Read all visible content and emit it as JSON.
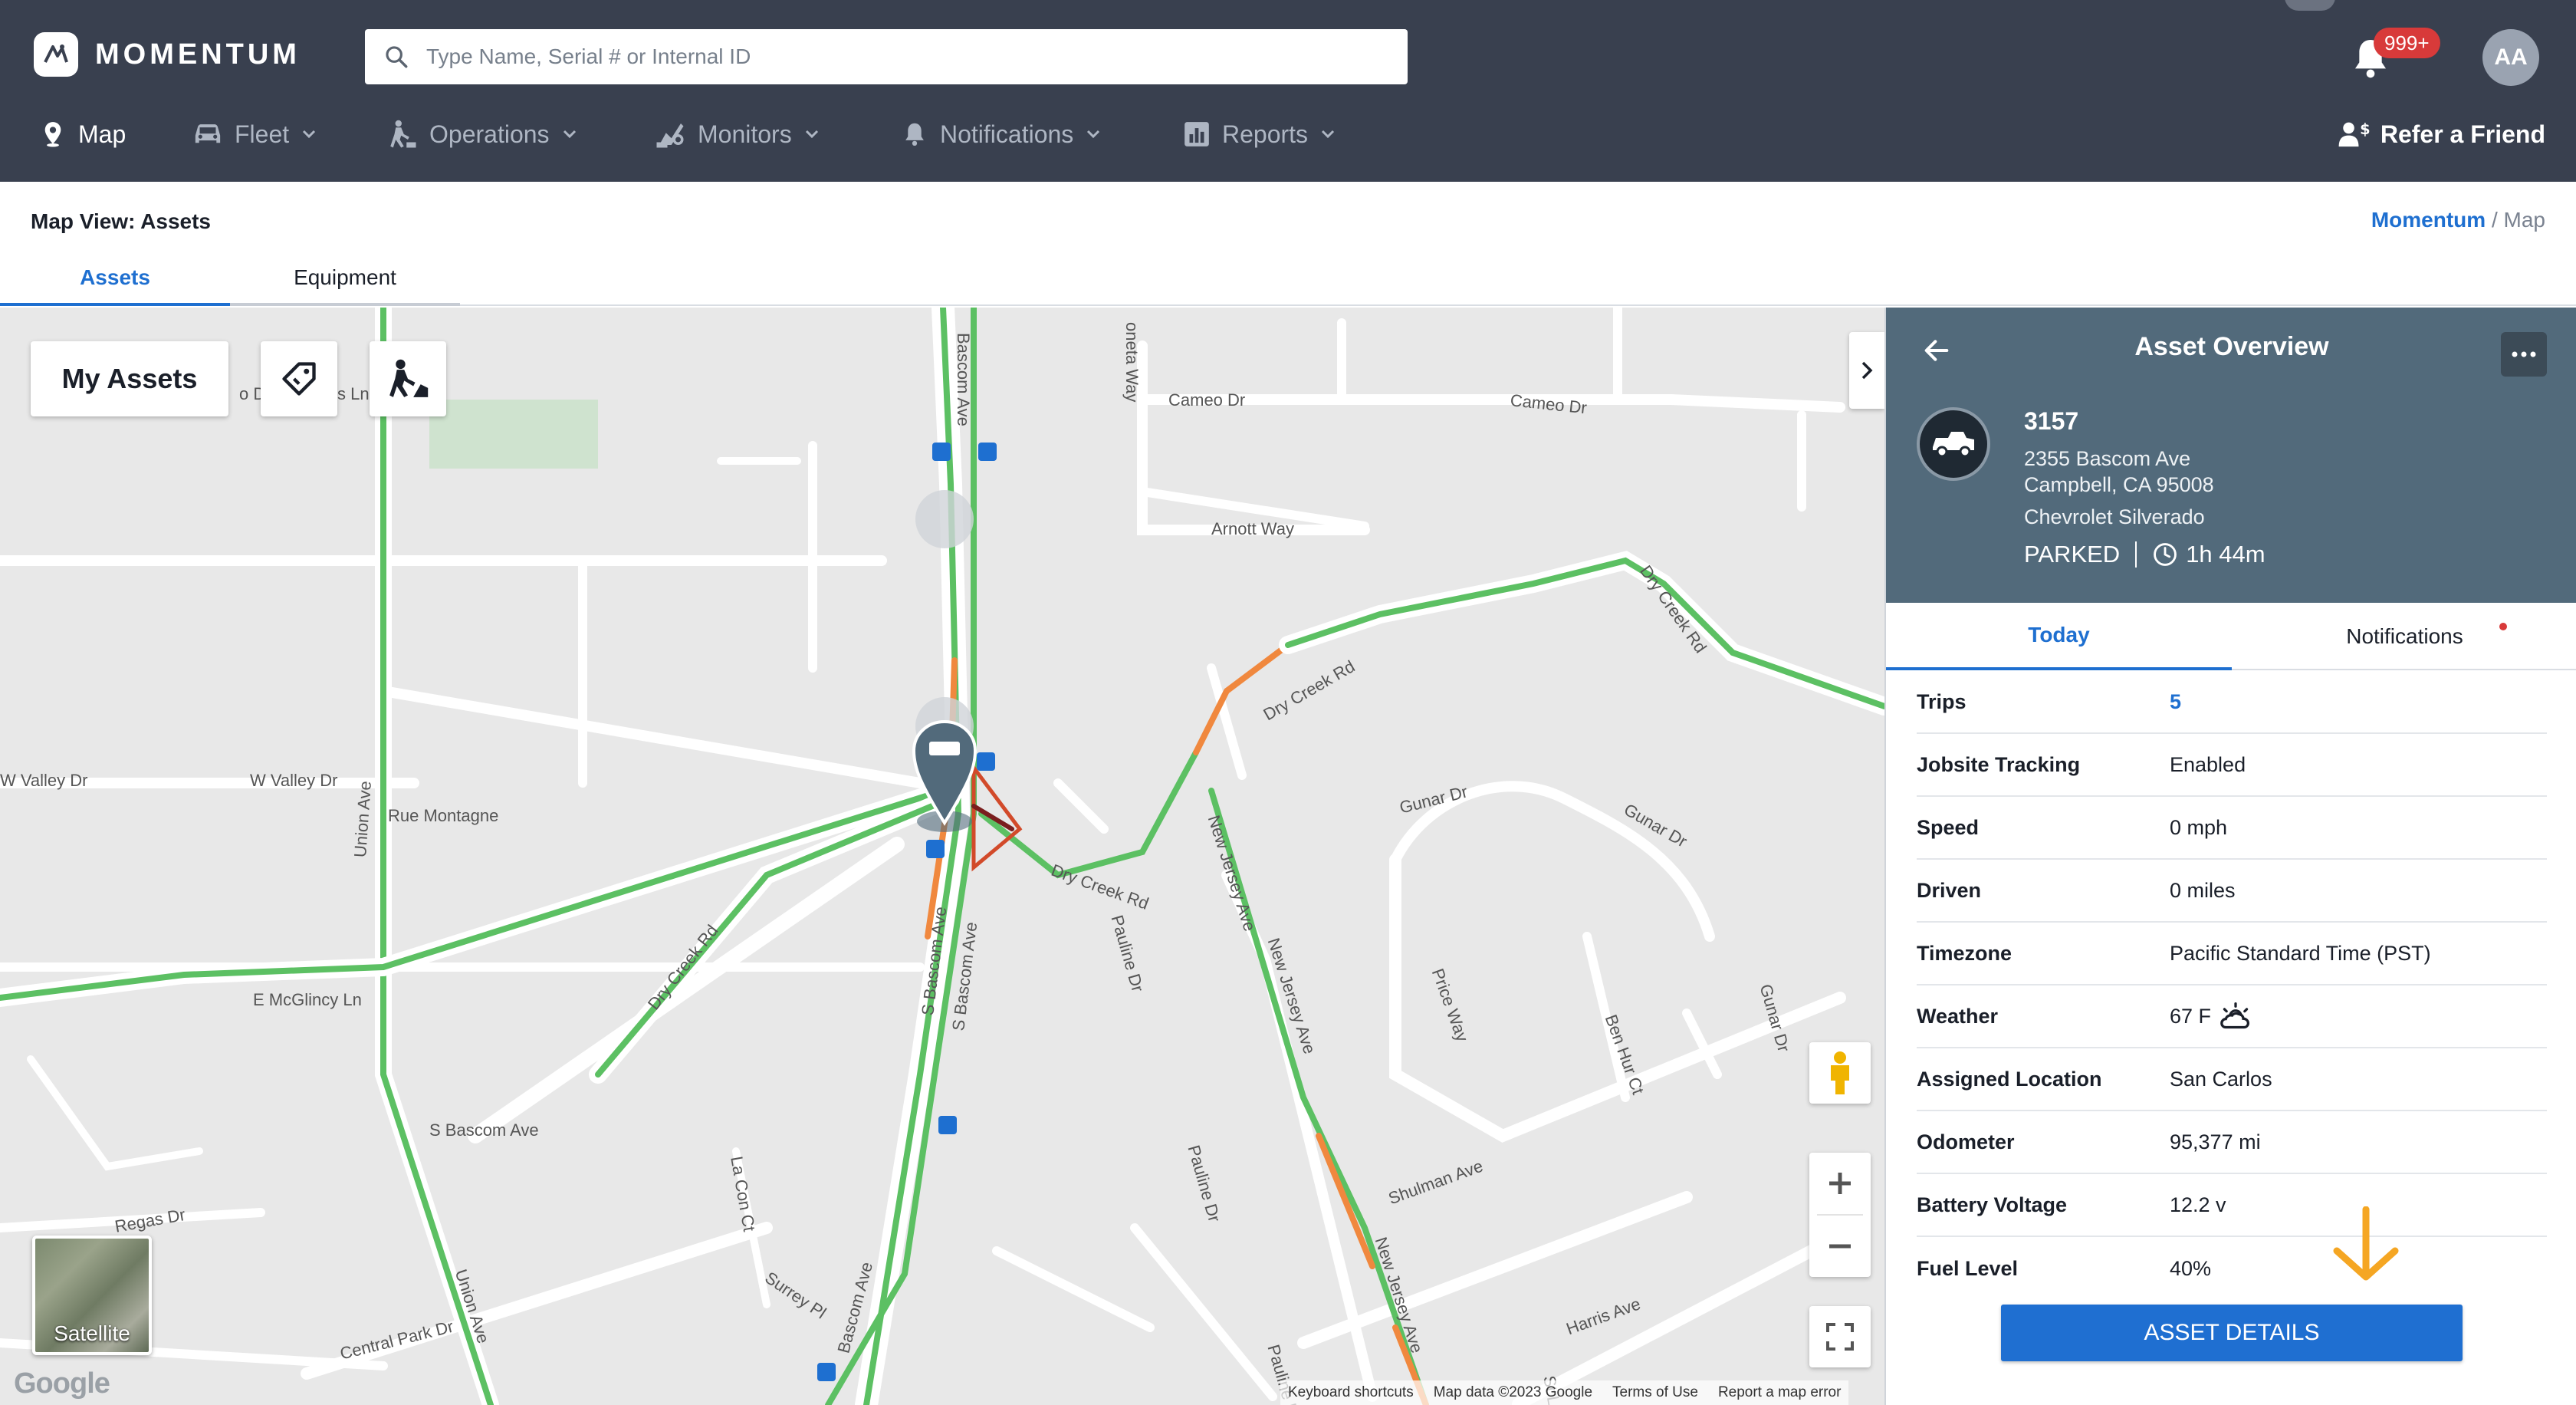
{
  "app": {
    "brand": "MOMENTUM",
    "search_placeholder": "Type Name, Serial # or Internal ID",
    "notifications_badge": "999+",
    "avatar_initials": "AA",
    "nav": [
      {
        "label": "Map",
        "icon": "map-pin-icon",
        "active": true
      },
      {
        "label": "Fleet",
        "icon": "car-icon"
      },
      {
        "label": "Operations",
        "icon": "operations-icon"
      },
      {
        "label": "Monitors",
        "icon": "monitors-icon"
      },
      {
        "label": "Notifications",
        "icon": "bell-icon"
      },
      {
        "label": "Reports",
        "icon": "reports-icon"
      }
    ],
    "refer_label": "Refer a Friend"
  },
  "subheader": {
    "title": "Map View: Assets",
    "breadcrumb_root": "Momentum",
    "breadcrumb_sep": " / ",
    "breadcrumb_current": "Map",
    "tabs": [
      {
        "label": "Assets",
        "active": true
      },
      {
        "label": "Equipment",
        "active": false
      }
    ]
  },
  "map": {
    "my_assets_label": "My Assets",
    "satellite_label": "Satellite",
    "google_logo": "Google",
    "footer": [
      "Keyboard shortcuts",
      "Map data ©2023 Google",
      "Terms of Use",
      "Report a map error"
    ],
    "street_labels": [
      "Cameo Dr",
      "Cameo Dr",
      "Arnott Way",
      "Dry Creek Rd",
      "Dry Creek Rd",
      "Dry Creek Rd",
      "Dry Creek Rd",
      "W Valley Dr",
      "W Valley Dr",
      "Rue Montagne",
      "Union Ave",
      "Union Ave",
      "Bascom Ave",
      "S Bascom Ave",
      "S Bascom Ave",
      "Bascom Ave",
      "S Bascom Ave",
      "E McGlincy Ln",
      "Pauline Dr",
      "Pauline Dr",
      "Pauline Dr",
      "New Jersey Ave",
      "New Jersey Ave",
      "New Jersey Ave",
      "Gunar Dr",
      "Gunar Dr",
      "Gunar Dr",
      "Price Way",
      "Ben Hur Ct",
      "Shulman Ave",
      "Harris Ave",
      "Central Park Dr",
      "Surrey Pl",
      "La Con Ct",
      "Regas Dr",
      "oneta Way",
      "o De",
      "s Ln",
      "St L"
    ]
  },
  "panel": {
    "title": "Asset Overview",
    "asset_id": "3157",
    "address_line1": "2355 Bascom Ave",
    "address_line2": "Campbell, CA 95008",
    "vehicle": "Chevrolet Silverado",
    "status": "PARKED",
    "duration": "1h 44m",
    "tabs": [
      {
        "label": "Today",
        "active": true
      },
      {
        "label": "Notifications",
        "active": false
      }
    ],
    "rows": [
      {
        "label": "Trips",
        "value": "5"
      },
      {
        "label": "Jobsite Tracking",
        "value": "Enabled"
      },
      {
        "label": "Speed",
        "value": "0 mph"
      },
      {
        "label": "Driven",
        "value": "0 miles"
      },
      {
        "label": "Timezone",
        "value": "Pacific Standard Time (PST)"
      },
      {
        "label": "Weather",
        "value": "67 F"
      },
      {
        "label": "Assigned Location",
        "value": "San Carlos"
      },
      {
        "label": "Odometer",
        "value": "95,377 mi"
      },
      {
        "label": "Battery Voltage",
        "value": "12.2 v"
      },
      {
        "label": "Fuel Level",
        "value": "40%"
      }
    ],
    "button_label": "ASSET DETAILS"
  },
  "colors": {
    "topbar": "#39404f",
    "accent": "#1e6fd0",
    "panel_header": "#526a7b",
    "traffic_green": "#5cc063",
    "traffic_orange": "#f0883e",
    "notification_red": "#d83a3a",
    "arrow_orange": "#f5a623"
  }
}
